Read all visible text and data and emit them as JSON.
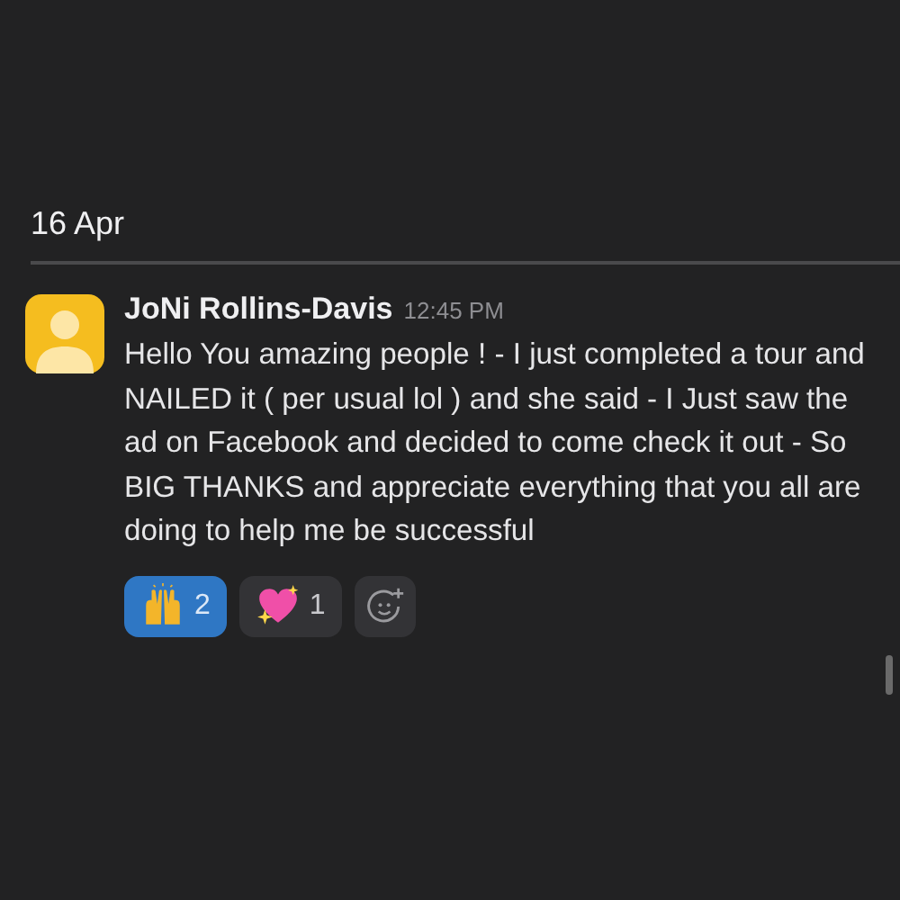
{
  "date_divider": "16 Apr",
  "message": {
    "author": "JoNi Rollins-Davis",
    "time": "12:45 PM",
    "text": "Hello You amazing people ! - I just completed a tour and NAILED it ( per usual lol ) and she said - I Just saw the ad on Facebook and decided to come check it out - So BIG THANKS and appreciate everything that you all are doing to help me be successful",
    "reactions": [
      {
        "kind": "hands",
        "count": "2",
        "selected": true
      },
      {
        "kind": "heart",
        "count": "1",
        "selected": false
      }
    ]
  }
}
